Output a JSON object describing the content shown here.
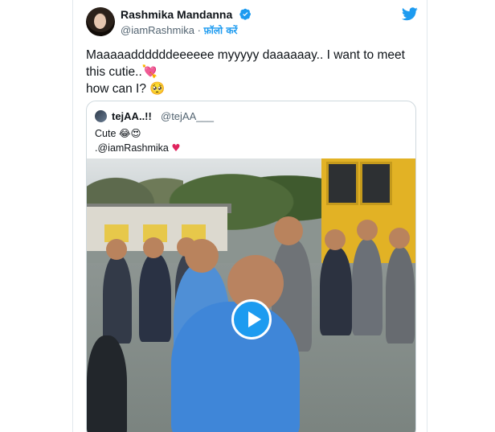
{
  "author": {
    "name": "Rashmika Mandanna",
    "handle": "@iamRashmika",
    "separator": "·",
    "follow_label": "फ़ॉलो करें"
  },
  "tweet": {
    "line1": "Maaaaaddddddeeeeee myyyyy daaaaaay.. I want to meet",
    "line2": "this cutie..",
    "line2_emoji": "💘",
    "line3": "how can I?",
    "line3_emoji": "🥺"
  },
  "quoted": {
    "name": "tejAA",
    "name_suffix": "..!!",
    "handle": "@tejAA___",
    "text_line1": "Cute",
    "text_line1_emoji": "😂😍",
    "text_line2": ".@iamRashmika",
    "text_line2_heart": "♥"
  },
  "icons": {
    "verified": "verified-badge-icon",
    "brand": "twitter-bird-icon",
    "play": "play-icon"
  },
  "colors": {
    "accent": "#1d9bf0",
    "heart": "#e0245e",
    "muted": "#536471"
  }
}
